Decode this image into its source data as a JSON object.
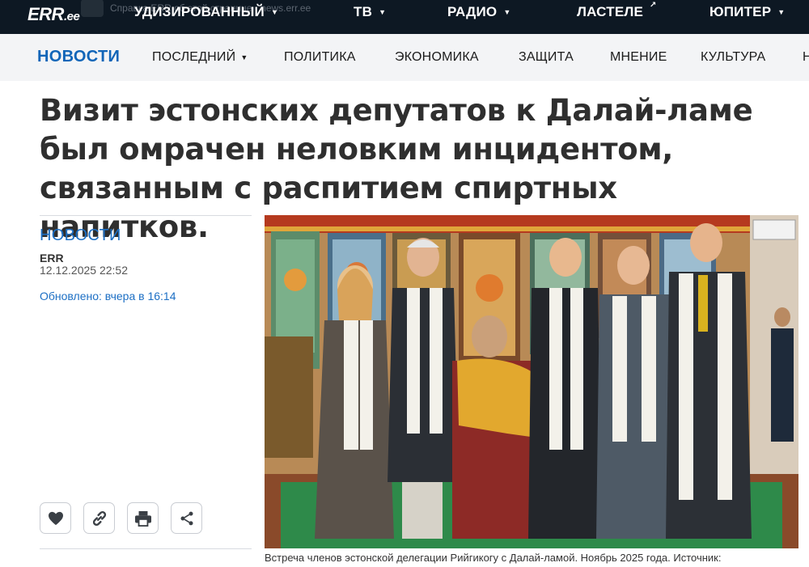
{
  "topbar": {
    "logo_main": "ERR",
    "logo_suffix": ".ee",
    "ghost_text": "Справка ERR об этой странице · news.err.ee",
    "nav": [
      {
        "label": "УДИЗИРОВАННЫЙ",
        "has_caret": true
      },
      {
        "label": "ТВ",
        "has_caret": true
      },
      {
        "label": "РАДИО",
        "has_caret": true
      },
      {
        "label": "ЛАСТЕЛЕ",
        "external": true
      },
      {
        "label": "ЮПИТЕР",
        "has_caret": true
      }
    ]
  },
  "subnav": {
    "brand": "НОВОСТИ",
    "items": [
      {
        "label": "ПОСЛЕДНИЙ",
        "has_caret": true
      },
      {
        "label": "ПОЛИТИКА"
      },
      {
        "label": "ЭКОНОМИКА"
      },
      {
        "label": "ЗАЩИТА"
      },
      {
        "label": "МНЕНИЕ"
      },
      {
        "label": "КУЛЬТУРА"
      },
      {
        "label": "Н"
      }
    ]
  },
  "article": {
    "title": "Визит эстонских депутатов к Далай-ламе был омрачен неловким инцидентом, связанным с распитием спиртных напитков.",
    "category": "НОВОСТИ",
    "author": "ERR",
    "date": "12.12.2025 22:52",
    "updated": "Обновлено: вчера в 16:14",
    "caption": "Встреча членов эстонской делегации Рийгикогу с Далай-ламой. Ноябрь 2025 года. Источник:"
  },
  "actions": [
    {
      "name": "like-button",
      "icon": "heart-icon"
    },
    {
      "name": "copy-link-button",
      "icon": "link-icon"
    },
    {
      "name": "print-button",
      "icon": "printer-icon"
    },
    {
      "name": "share-button",
      "icon": "share-icon"
    }
  ],
  "colors": {
    "topbar_bg": "#0d1823",
    "subnav_bg": "#f3f4f6",
    "accent_blue": "#1d6fc4",
    "title_text": "#2f2f2f"
  }
}
